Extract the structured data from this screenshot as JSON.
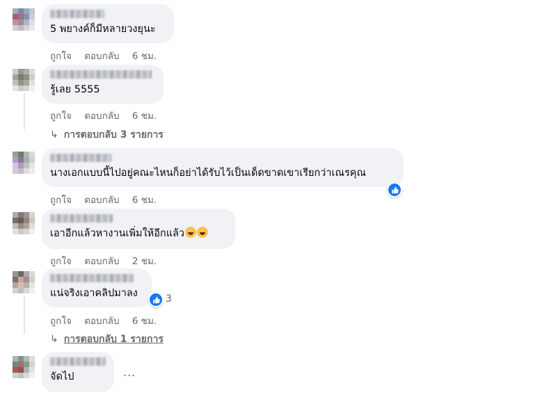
{
  "actions": {
    "like": "ถูกใจ",
    "reply": "ตอบกลับ"
  },
  "comments": [
    {
      "text": "5 พยางค์ก็มีหลายวงยุนะ",
      "time": "6 ชม."
    },
    {
      "text": "รู้เลย 5555",
      "time": "6 ชม.",
      "replies_label": "การตอบกลับ 3 รายการ"
    },
    {
      "text": "นางเอกแบบนี้ไปอยู่คณะไหนก็อย่าได้รับไว้เป็นเด็ดขาดเขาเรียกว่าเณรคุณ",
      "time": "6 ชม.",
      "reaction": "like"
    },
    {
      "text": "เอาอีกแล้วหางานเพิ่มให้อีกแล้ว",
      "time": "2 ชม.",
      "emoji": [
        "laughing-crying-emoji",
        "laughing-crying-emoji"
      ]
    },
    {
      "text": "แน่จริงเอาคลิปมาลง",
      "time": "6 ชม.",
      "reaction": "like",
      "reaction_count": "3",
      "replies_label": "การตอบกลับ 1 รายการ"
    },
    {
      "text": "จัดไป",
      "more": "..."
    }
  ],
  "colors": {
    "bubble": "#f0f2f5",
    "meta": "#65676b",
    "like": "#1877f2"
  }
}
